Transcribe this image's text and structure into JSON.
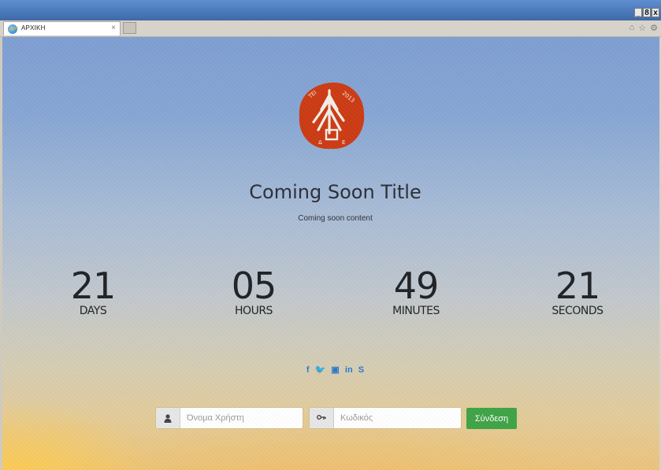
{
  "browser": {
    "tab_title": "ΑΡΧΙΚΗ",
    "tab_close": "×",
    "window_controls": [
      "_",
      "8",
      "x"
    ],
    "icons": [
      "home-icon",
      "star-icon",
      "gear-icon"
    ]
  },
  "page": {
    "title": "Coming Soon Title",
    "subtitle": "Coming soon content",
    "countdown": [
      {
        "value": "21",
        "label": "DAYS"
      },
      {
        "value": "05",
        "label": "HOURS"
      },
      {
        "value": "49",
        "label": "MINUTES"
      },
      {
        "value": "21",
        "label": "SECONDS"
      }
    ],
    "social": [
      {
        "icon": "facebook-icon",
        "glyph": "f"
      },
      {
        "icon": "twitter-icon",
        "glyph": "🐦"
      },
      {
        "icon": "youtube-icon",
        "glyph": "▣"
      },
      {
        "icon": "linkedin-icon",
        "glyph": "in"
      },
      {
        "icon": "skype-icon",
        "glyph": "S"
      }
    ],
    "login": {
      "username_placeholder": "Όνομα Χρήστη",
      "password_placeholder": "Κωδικός",
      "submit_label": "Σύνδεση"
    }
  },
  "colors": {
    "logo_red": "#cc3b14",
    "button_green": "#3fa447",
    "social_blue": "#2d78c8"
  }
}
